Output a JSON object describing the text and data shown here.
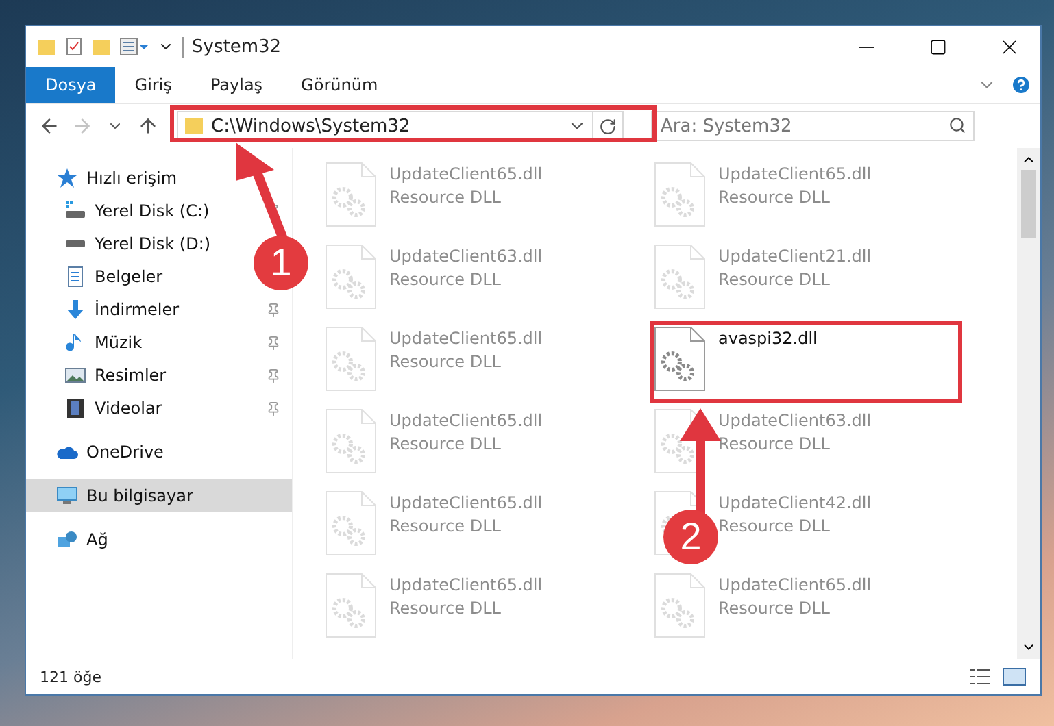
{
  "window": {
    "title": "System32"
  },
  "ribbon_tabs": [
    {
      "label": "Dosya",
      "kind": "file"
    },
    {
      "label": "Giriş",
      "kind": "tab"
    },
    {
      "label": "Paylaş",
      "kind": "tab"
    },
    {
      "label": "Görünüm",
      "kind": "tab"
    }
  ],
  "navigation": {
    "forward_disabled": true,
    "address": "C:\\Windows\\System32",
    "search": {
      "placeholder": "Ara: System32"
    }
  },
  "sidebar": {
    "items": [
      {
        "label": "Hızlı erişim",
        "kind": "star",
        "selected": false,
        "children": [
          {
            "label": "Yerel Disk (C:)",
            "kind": "drive-windows",
            "pinned": true,
            "selected": false
          },
          {
            "label": "Yerel Disk (D:)",
            "kind": "drive",
            "pinned": false,
            "selected": false
          },
          {
            "label": "Belgeler",
            "kind": "document",
            "pinned": false,
            "selected": false
          },
          {
            "label": "İndirmeler",
            "kind": "download",
            "pinned": true,
            "selected": false
          },
          {
            "label": "Müzik",
            "kind": "music",
            "pinned": true,
            "selected": false
          },
          {
            "label": "Resimler",
            "kind": "pictures",
            "pinned": true,
            "selected": false
          },
          {
            "label": "Videolar",
            "kind": "videos",
            "pinned": true,
            "selected": false
          }
        ]
      },
      {
        "label": "OneDrive",
        "kind": "cloud",
        "selected": false
      },
      {
        "label": "Bu bilgisayar",
        "kind": "computer",
        "selected": true
      },
      {
        "label": "Ağ",
        "kind": "network",
        "selected": false
      }
    ]
  },
  "files": [
    {
      "name": "UpdateClient65.dll",
      "type": "Resource DLL",
      "dimmed": true
    },
    {
      "name": "UpdateClient65.dll",
      "type": "Resource DLL",
      "dimmed": true
    },
    {
      "name": "UpdateClient63.dll",
      "type": "Resource DLL",
      "dimmed": true
    },
    {
      "name": "UpdateClient21.dll",
      "type": "Resource DLL",
      "dimmed": true
    },
    {
      "name": "UpdateClient65.dll",
      "type": "Resource DLL",
      "dimmed": true
    },
    {
      "name": "avaspi32.dll",
      "dimmed": false
    },
    {
      "name": "UpdateClient65.dll",
      "type": "Resource DLL",
      "dimmed": true
    },
    {
      "name": "UpdateClient63.dll",
      "type": "Resource DLL",
      "dimmed": true
    },
    {
      "name": "UpdateClient65.dll",
      "type": "Resource DLL",
      "dimmed": true
    },
    {
      "name": "UpdateClient42.dll",
      "type": "Resource DLL",
      "dimmed": true
    },
    {
      "name": "UpdateClient65.dll",
      "type": "Resource DLL",
      "dimmed": true
    },
    {
      "name": "UpdateClient65.dll",
      "type": "Resource DLL",
      "dimmed": true
    }
  ],
  "status_bar": {
    "count": "121 öğe"
  },
  "annotations": [
    {
      "number": "1",
      "kind": "address"
    },
    {
      "number": "2",
      "kind": "file"
    }
  ]
}
